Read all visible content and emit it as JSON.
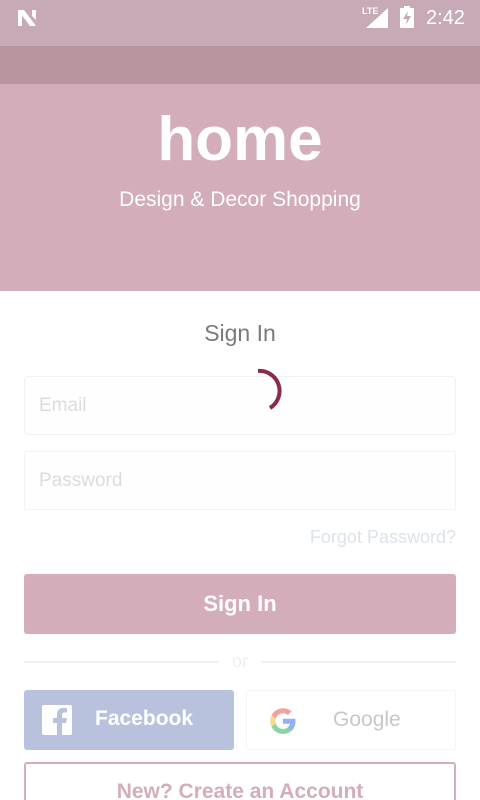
{
  "status_bar": {
    "network": "LTE",
    "time": "2:42"
  },
  "hero": {
    "logo_text": "home",
    "tagline": "Design & Decor Shopping"
  },
  "signin": {
    "title": "Sign In",
    "email_placeholder": "Email",
    "password_placeholder": "Password",
    "forgot_password": "Forgot Password?",
    "button_label": "Sign In",
    "or_label": "or"
  },
  "social": {
    "facebook_label": "Facebook",
    "google_label": "Google"
  },
  "create_account": {
    "label": "New? Create an Account"
  },
  "colors": {
    "brand_pink": "#d3adba",
    "spinner": "#8a2a4e",
    "facebook": "#b8c2dc"
  }
}
